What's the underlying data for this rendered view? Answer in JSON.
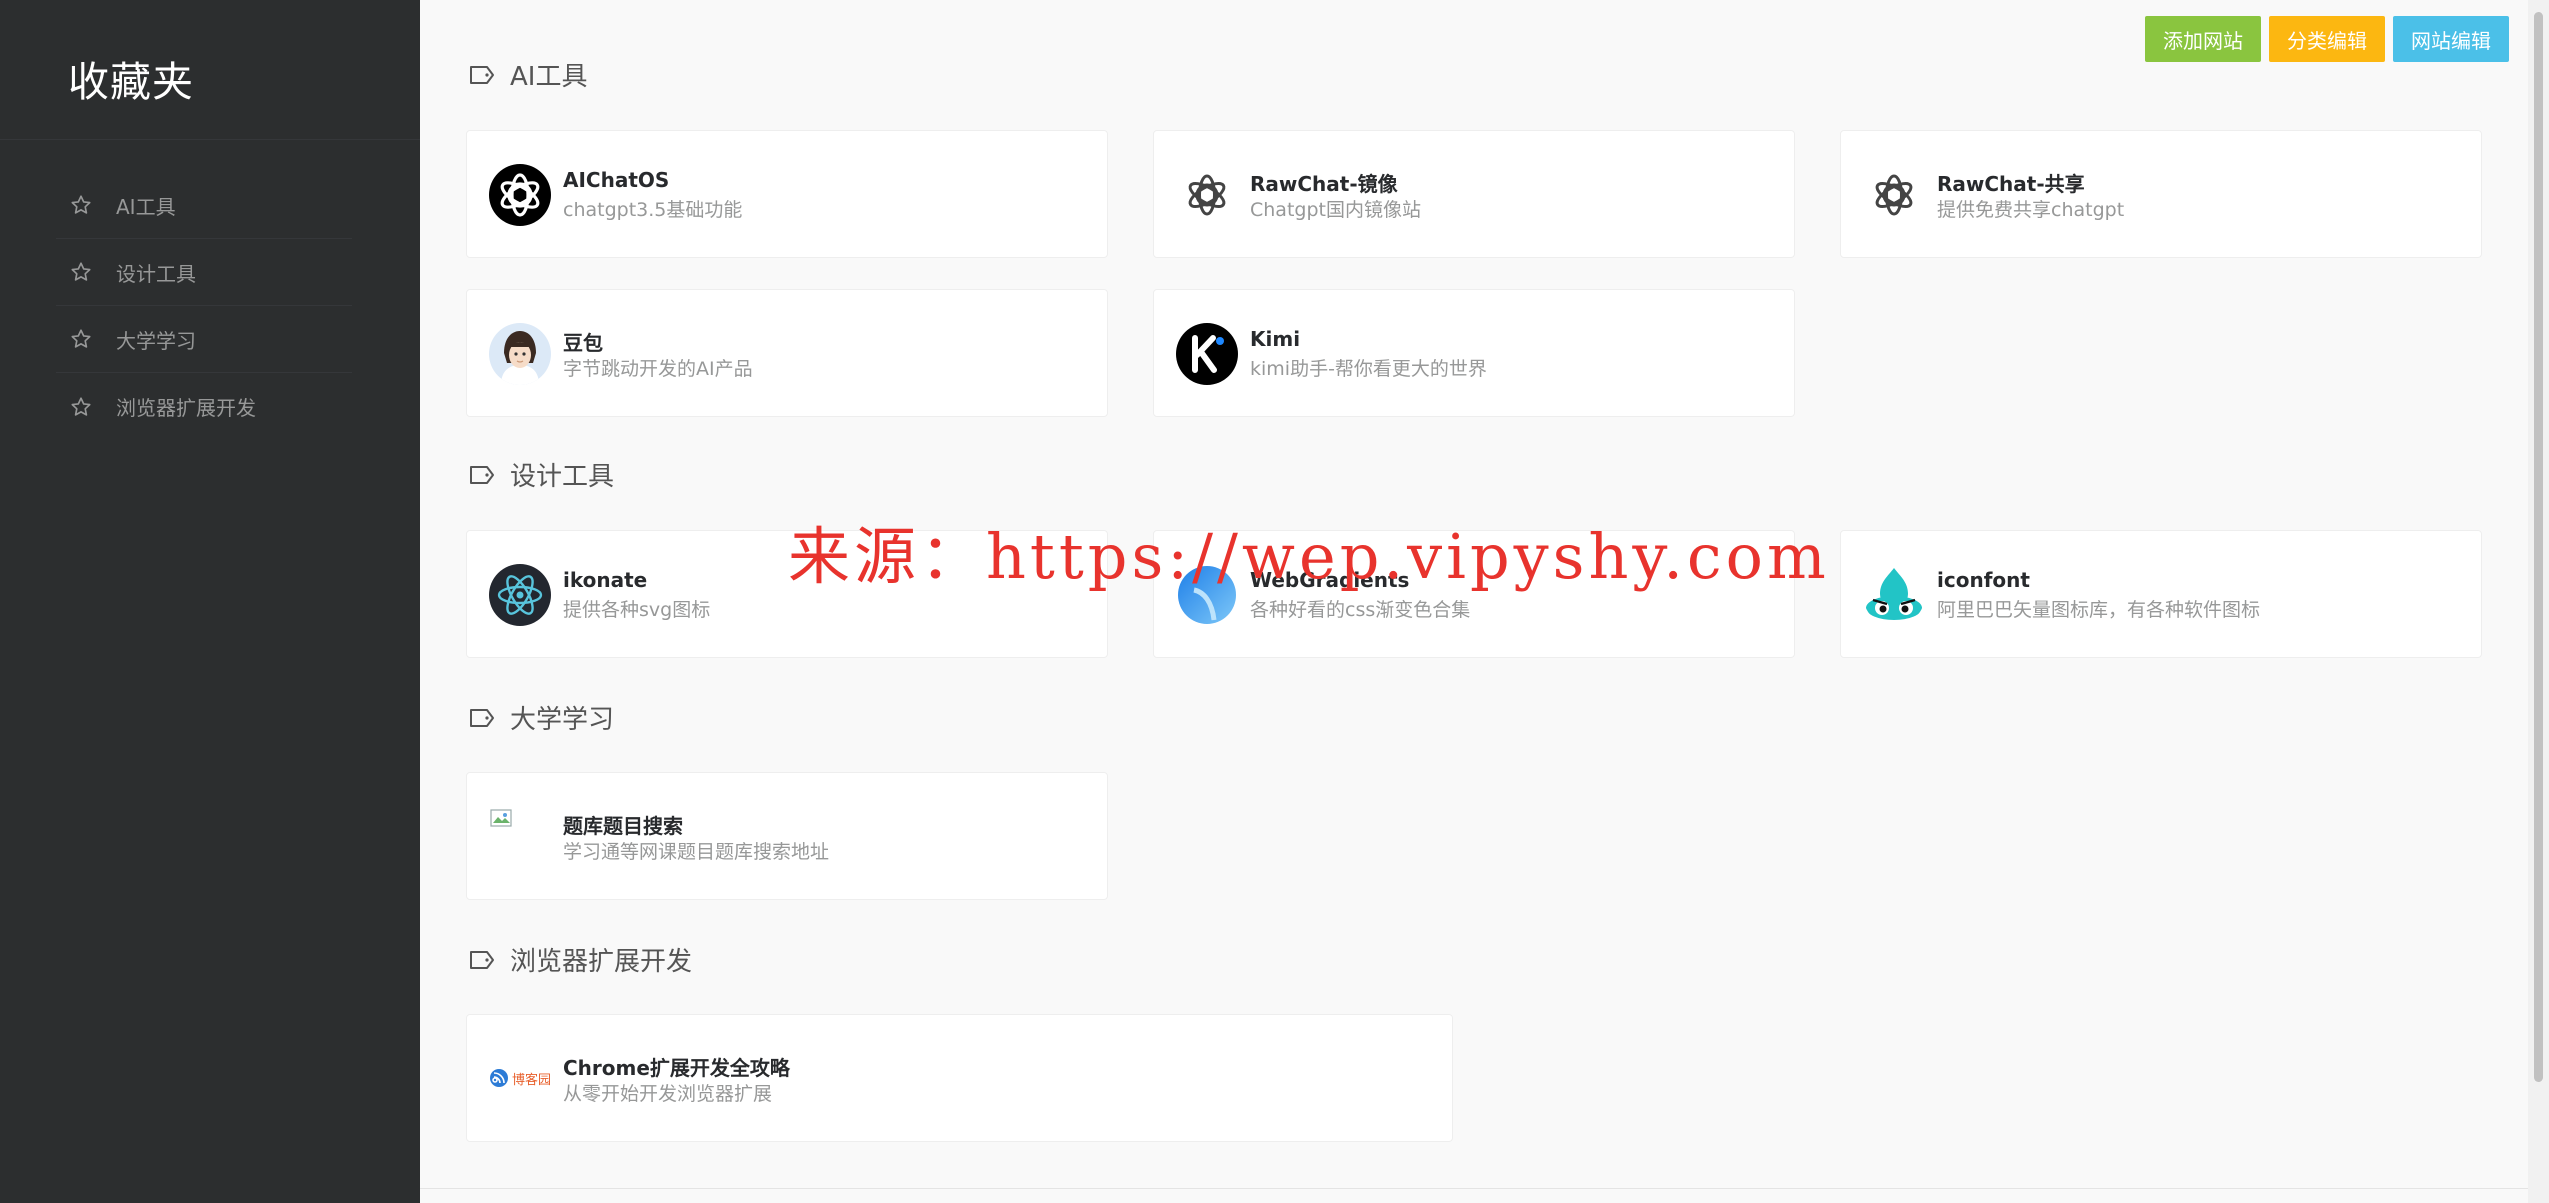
{
  "sidebar": {
    "title": "收藏夹",
    "items": [
      {
        "label": "AI工具"
      },
      {
        "label": "设计工具"
      },
      {
        "label": "大学学习"
      },
      {
        "label": "浏览器扩展开发"
      }
    ]
  },
  "toolbar": {
    "add_site": "添加网站",
    "edit_category": "分类编辑",
    "edit_site": "网站编辑",
    "colors": {
      "add": "#8ac53f",
      "category": "#fcb711",
      "site": "#4bc0e8"
    }
  },
  "sections": [
    {
      "title": "AI工具",
      "sites": [
        {
          "name": "AIChatOS",
          "desc": "chatgpt3.5基础功能",
          "icon": "openai-logo-icon"
        },
        {
          "name": "RawChat-镜像",
          "desc": "Chatgpt国内镜像站",
          "icon": "openai-logo-icon"
        },
        {
          "name": "RawChat-共享",
          "desc": "提供免费共享chatgpt",
          "icon": "openai-logo-icon"
        },
        {
          "name": "豆包",
          "desc": "字节跳动开发的AI产品",
          "icon": "doubao-avatar-icon"
        },
        {
          "name": "Kimi",
          "desc": "kimi助手-帮你看更大的世界",
          "icon": "kimi-logo-icon"
        }
      ]
    },
    {
      "title": "设计工具",
      "sites": [
        {
          "name": "ikonate",
          "desc": "提供各种svg图标",
          "icon": "react-atom-icon"
        },
        {
          "name": "WebGradients",
          "desc": "各种好看的css渐变色合集",
          "icon": "webgradients-logo-icon"
        },
        {
          "name": "iconfont",
          "desc": "阿里巴巴矢量图标库，有各种软件图标",
          "icon": "iconfont-logo-icon"
        }
      ]
    },
    {
      "title": "大学学习",
      "sites": [
        {
          "name": "题库题目搜索",
          "desc": "学习通等网课题目题库搜索地址",
          "icon": "broken-image-icon"
        }
      ]
    },
    {
      "title": "浏览器扩展开发",
      "sites": [
        {
          "name": "Chrome扩展开发全攻略",
          "desc": "从零开始开发浏览器扩展",
          "icon": "cnblogs-logo-icon",
          "logo_text": "博客园"
        }
      ]
    }
  ],
  "watermark": "来源：https://wep.vipyshy.com"
}
